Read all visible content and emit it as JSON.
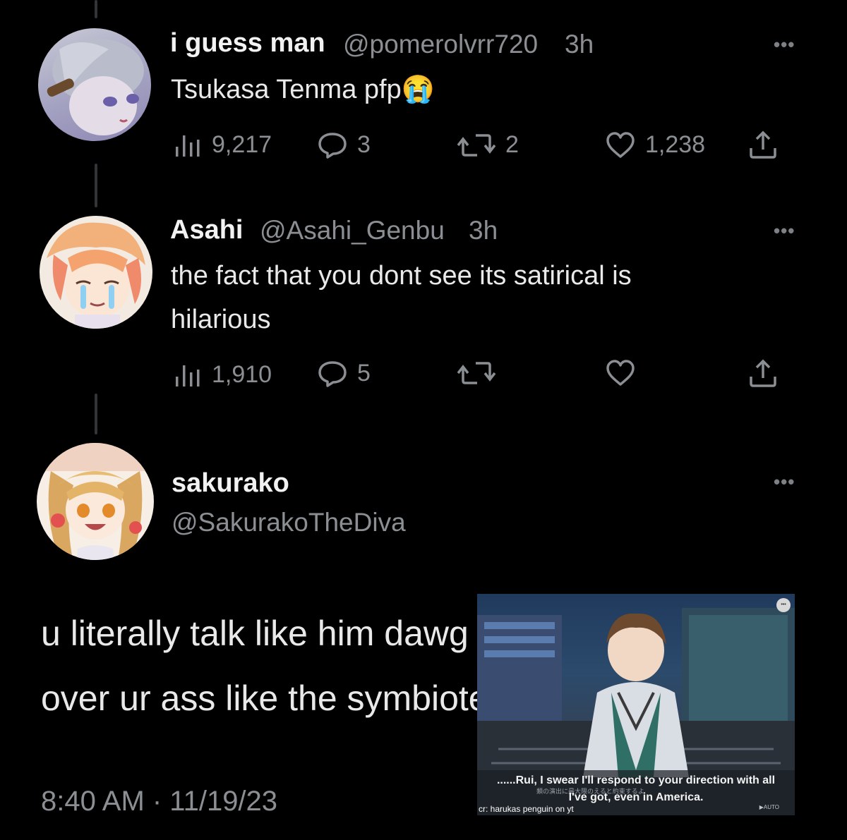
{
  "tweets": [
    {
      "display_name": "i guess man",
      "handle": "@pomerolvrr720",
      "time": "3h",
      "text": "Tsukasa Tenma pfp😭",
      "views": "9,217",
      "replies": "3",
      "reposts": "2",
      "likes": "1,238"
    },
    {
      "display_name": "Asahi",
      "handle": "@Asahi_Genbu",
      "time": "3h",
      "text_line1": "the fact that you dont see its satirical is",
      "text_line2": "hilarious",
      "views": "1,910",
      "replies": "5"
    }
  ],
  "main_tweet": {
    "display_name": "sakurako",
    "handle": "@SakurakoTheDiva",
    "text_line1": "u literally talk like him dawg hes taking",
    "text_line2": "over ur ass like the symbiote",
    "timestamp": "8:40 AM · 11/19/23"
  },
  "more_label": "•••",
  "video_overlay": {
    "subtitle_en_line1": "......Rui, I swear I'll respond to your direction with all",
    "subtitle_en_line2": "I've got, even in America.",
    "subtitle_jp": "類の演出に最大限のえると約束するよ",
    "credit": "cr: harukas penguin on yt",
    "auto_label": "▶AUTO",
    "menu_glyph": "•••"
  },
  "colors": {
    "background": "#000000",
    "muted": "#8b8f93",
    "name": "#f2f2f2"
  }
}
